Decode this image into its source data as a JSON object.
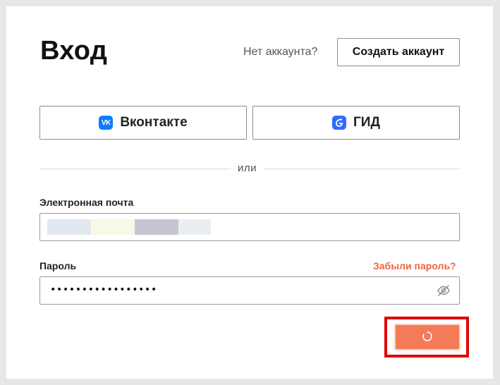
{
  "header": {
    "title": "Вход",
    "no_account_text": "Нет аккаунта?",
    "create_account_label": "Создать аккаунт"
  },
  "social": {
    "vk_label": "Вконтакте",
    "vk_icon": "vk-logo-icon",
    "gid_label": "ГИД",
    "gid_icon": "gid-logo-icon"
  },
  "divider": {
    "text": "или"
  },
  "form": {
    "email_label": "Электронная почта",
    "email_value_redacted": true,
    "password_label": "Пароль",
    "password_value": "•••••••••••••••••",
    "forgot_label": "Забыли пароль?",
    "submit_state": "loading"
  },
  "colors": {
    "accent": "#f47a58",
    "link": "#f0643f",
    "highlight": "#e00000",
    "vk_blue": "#0b7cff"
  }
}
